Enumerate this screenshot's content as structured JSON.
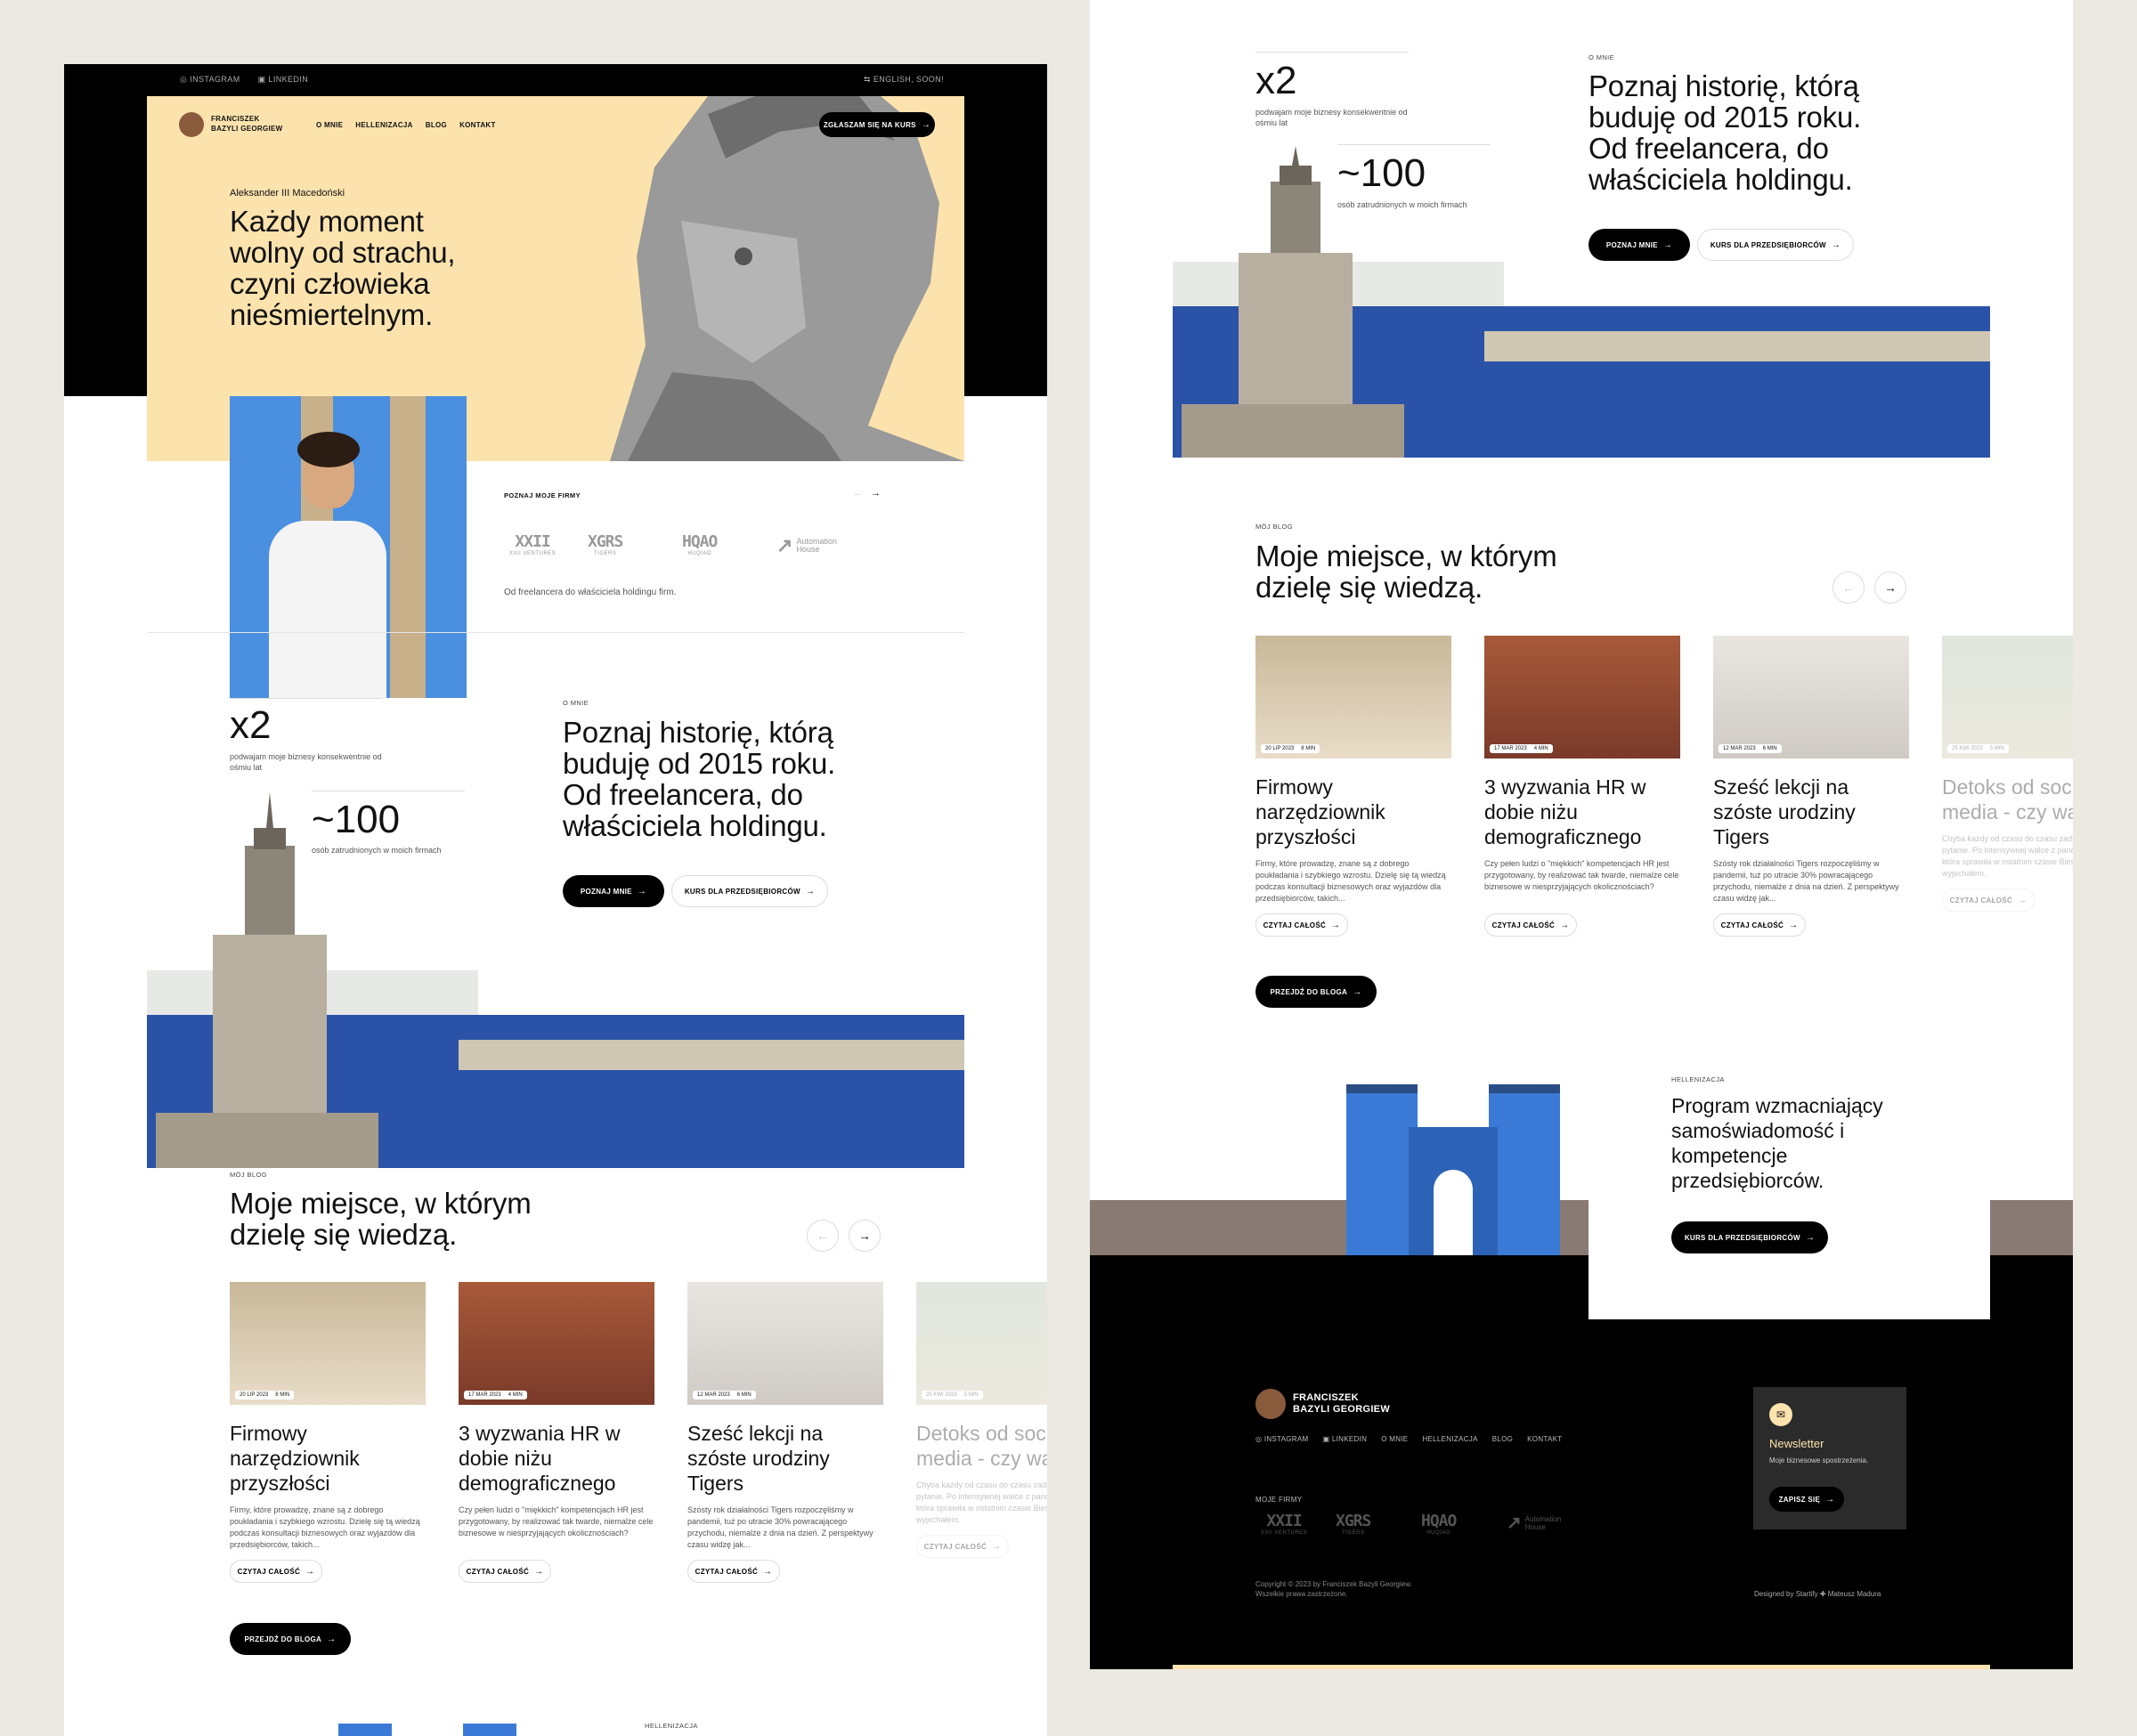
{
  "header": {
    "social": [
      "INSTAGRAM",
      "LINKEDIN"
    ],
    "lang": "ENGLISH, SOON!",
    "brand_line1": "FRANCISZEK",
    "brand_line2": "BAZYLI GEORGIEW",
    "nav": [
      "O MNIE",
      "HELLENIZACJA",
      "BLOG",
      "KONTAKT"
    ],
    "cta": "ZGŁASZAM SIĘ NA KURS"
  },
  "hero": {
    "author": "Aleksander III Macedoński",
    "quote": "Każdy moment wolny od strachu, czyni człowieka nieśmiertelnym."
  },
  "firms": {
    "label": "POZNAJ MOJE FIRMY",
    "logos": [
      {
        "name": "XXII",
        "sub": "XXII VENTURES"
      },
      {
        "name": "XGRS",
        "sub": "TIGERS"
      },
      {
        "name": "HQAO",
        "sub": "HUQIAO"
      },
      {
        "name": "Automation House",
        "sub": ""
      }
    ],
    "caption": "Od freelancera do właściciela holdingu firm."
  },
  "about": {
    "stat1_value": "x2",
    "stat1_text": "podwajam moje biznesy konsekwentnie od ośmiu lat",
    "stat2_value": "~100",
    "stat2_text": "osób zatrudnionych w moich firmach",
    "label": "O MNIE",
    "heading": "Poznaj historię, którą buduję od 2015 roku. Od freelancera, do właściciela holdingu.",
    "btn_primary": "POZNAJ MNIE",
    "btn_secondary": "KURS DLA PRZEDSIĘBIORCÓW"
  },
  "blog": {
    "label": "MÓJ BLOG",
    "heading": "Moje miejsce, w którym dzielę się wiedzą.",
    "read_label": "CZYTAJ CAŁOŚĆ",
    "all_label": "PRZEJDŹ DO BLOGA",
    "posts": [
      {
        "date": "20 LIP 2023",
        "time": "8 MIN",
        "title": "Firmowy narzędziownik przyszłości",
        "excerpt": "Firmy, które prowadzę, znane są z dobrego poukładania i szybkiego wzrostu. Dzielę się tą wiedzą podczas konsultacji biznesowych oraz wyjazdów dla przedsiębiorców, takich..."
      },
      {
        "date": "17 MAR 2023",
        "time": "4 MIN",
        "title": "3 wyzwania HR w dobie niżu demograficznego",
        "excerpt": "Czy pełen ludzi o \"miękkich\" kompetencjach HR jest przygotowany, by realizować tak twarde, niemalże cele biznesowe w niesprzyjających okolicznościach?"
      },
      {
        "date": "12 MAR 2023",
        "time": "6 MIN",
        "title": "Sześć lekcji na szóste urodziny Tigers",
        "excerpt": "Szósty rok działalności Tigers rozpoczęliśmy w pandemii, tuż po utracie 30% powracającego przychodu, niemalże z dnia na dzień. Z perspektywy czasu widzę jak..."
      },
      {
        "date": "25 KWI 2023",
        "time": "5 MIN",
        "title": "Detoks od social media - czy warto?",
        "excerpt": "Chyba każdy od czasu do czasu zadaje sobie to pytanie. Po intensywnej walce z pandemią COVID-19, która sprawiła w ostatnim czasie Bieszczady nie wyjechałem."
      }
    ]
  },
  "hellen": {
    "label": "HELLENIZACJA",
    "heading": "Program wzmacniający samoświadomość i kompetencje przedsiębiorców.",
    "btn": "KURS DLA PRZEDSIĘBIORCÓW"
  },
  "footer": {
    "brand_line1": "FRANCISZEK",
    "brand_line2": "BAZYLI GEORGIEW",
    "links": [
      "INSTAGRAM",
      "LINKEDIN",
      "O MNIE",
      "HELLENIZACJA",
      "BLOG",
      "KONTAKT"
    ],
    "firms_label": "MOJE FIRMY",
    "newsletter_title": "Newsletter",
    "newsletter_text": "Moje biznesowe spostrzeżenia.",
    "newsletter_btn": "ZAPISZ SIĘ",
    "copyright1": "Copyright © 2023 by Franciszek Bazyli Georgiew.",
    "copyright2": "Wszelkie prawa zastrzeżone.",
    "designed": "Designed by Startify ✚ Mateusz Madura"
  },
  "colors": {
    "accent": "#fce3ad",
    "sea": "#2a53a8",
    "gate": "#3a7ad6",
    "dark": "#000000"
  }
}
